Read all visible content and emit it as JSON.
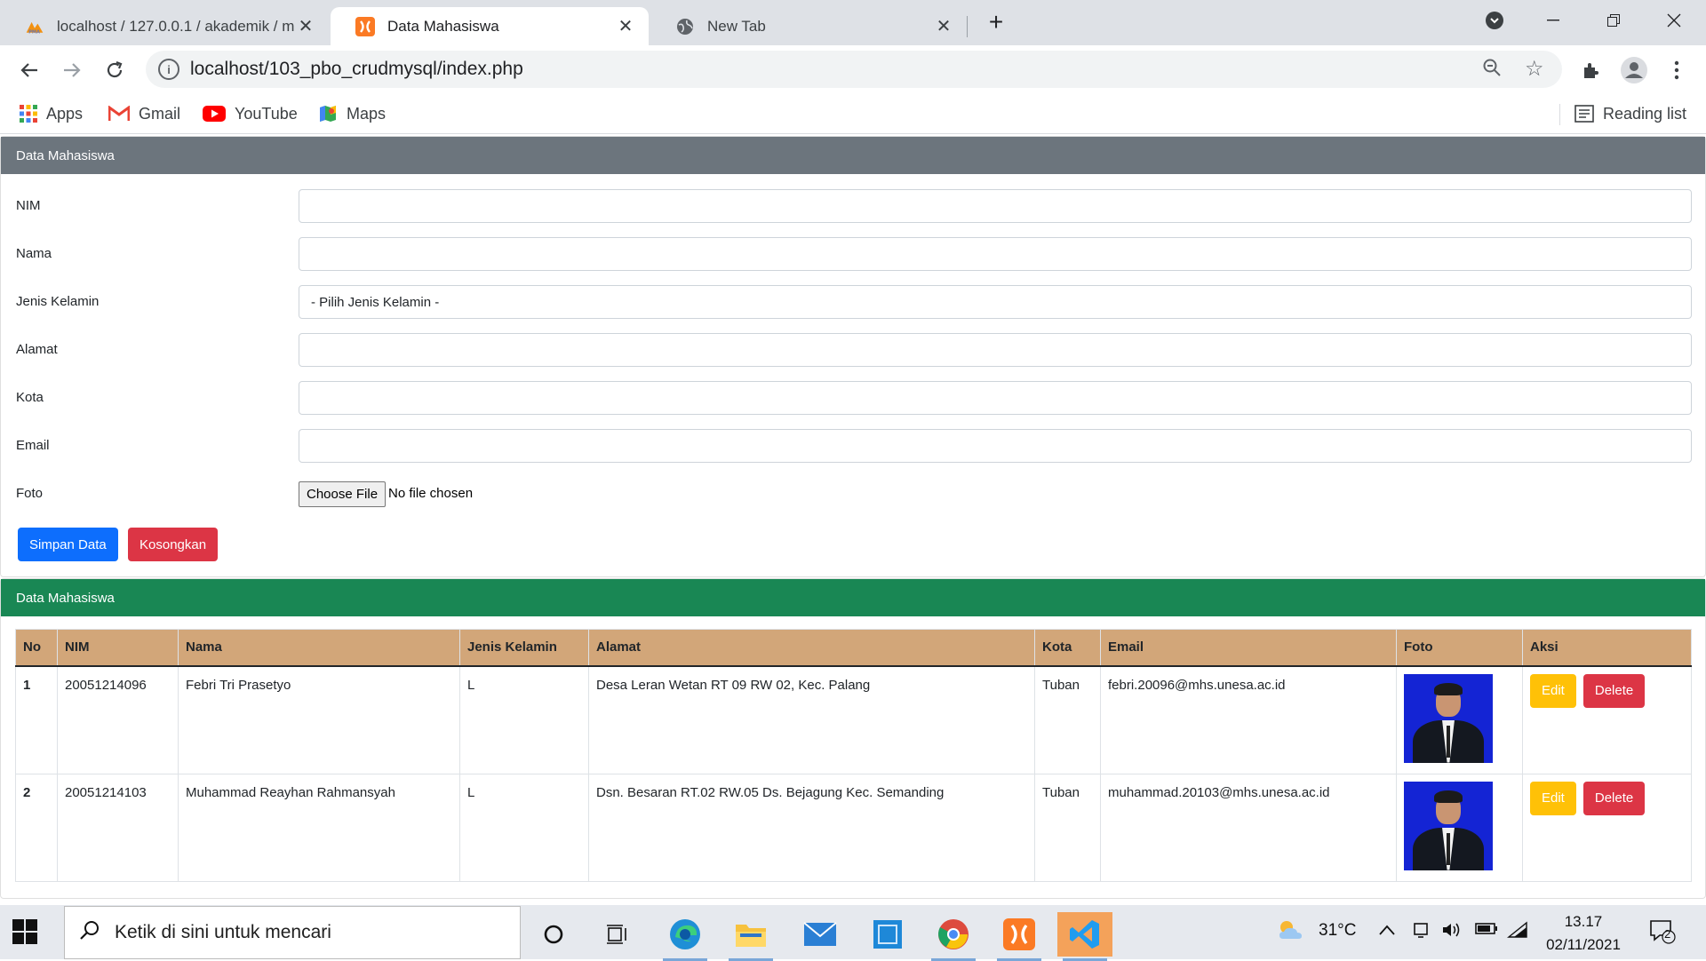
{
  "browser": {
    "tabs": [
      {
        "title": "localhost / 127.0.0.1 / akademik / m",
        "favicon": "phpmyadmin-icon",
        "active": false
      },
      {
        "title": "Data Mahasiswa",
        "favicon": "xampp-icon",
        "active": true
      },
      {
        "title": "New Tab",
        "favicon": "globe-icon",
        "active": false
      }
    ],
    "new_tab_symbol": "+",
    "url": "localhost/103_pbo_crudmysql/index.php",
    "bookmarks": [
      {
        "label": "Apps",
        "icon": "apps-grid-icon"
      },
      {
        "label": "Gmail",
        "icon": "gmail-icon"
      },
      {
        "label": "YouTube",
        "icon": "youtube-icon"
      },
      {
        "label": "Maps",
        "icon": "maps-icon"
      }
    ],
    "reading_list": "Reading list"
  },
  "form_card": {
    "header": "Data Mahasiswa",
    "fields": [
      {
        "label": "NIM",
        "value": ""
      },
      {
        "label": "Nama",
        "value": ""
      },
      {
        "label": "Jenis Kelamin",
        "value": "- Pilih Jenis Kelamin -"
      },
      {
        "label": "Alamat",
        "value": ""
      },
      {
        "label": "Kota",
        "value": ""
      },
      {
        "label": "Email",
        "value": ""
      }
    ],
    "foto_label": "Foto",
    "choose_file": "Choose File",
    "no_file": "No file chosen",
    "save_button": "Simpan Data",
    "clear_button": "Kosongkan"
  },
  "table_card": {
    "header": "Data Mahasiswa",
    "columns": [
      "No",
      "NIM",
      "Nama",
      "Jenis Kelamin",
      "Alamat",
      "Kota",
      "Email",
      "Foto",
      "Aksi"
    ],
    "rows": [
      {
        "no": "1",
        "nim": "20051214096",
        "nama": "Febri Tri Prasetyo",
        "jk": "L",
        "alamat": "Desa Leran Wetan RT 09 RW 02, Kec. Palang",
        "kota": "Tuban",
        "email": "febri.20096@mhs.unesa.ac.id"
      },
      {
        "no": "2",
        "nim": "20051214103",
        "nama": "Muhammad Reayhan Rahmansyah",
        "jk": "L",
        "alamat": "Dsn. Besaran RT.02 RW.05 Ds. Bejagung Kec. Semanding",
        "kota": "Tuban",
        "email": "muhammad.20103@mhs.unesa.ac.id"
      }
    ],
    "edit_label": "Edit",
    "delete_label": "Delete"
  },
  "taskbar": {
    "search_placeholder": "Ketik di sini untuk mencari",
    "temperature": "31°C",
    "time": "13.17",
    "date": "02/11/2021",
    "notification_count": "2"
  }
}
